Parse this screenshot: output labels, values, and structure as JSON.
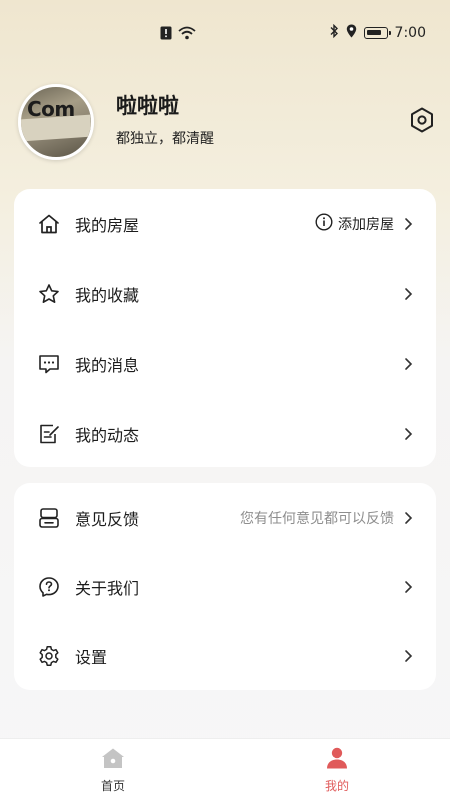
{
  "status_bar": {
    "time": "7:00",
    "battery_level": 0.85,
    "icons": [
      "alert-icon",
      "wifi-icon",
      "bluetooth-icon",
      "location-icon",
      "battery-icon"
    ]
  },
  "profile": {
    "name": "啦啦啦",
    "bio": "都独立，都清醒",
    "avatar_text": "Com"
  },
  "menu_card_1": [
    {
      "label": "我的房屋",
      "icon": "house-icon",
      "extra_icon": "info-icon",
      "extra_text": "添加房屋"
    },
    {
      "label": "我的收藏",
      "icon": "star-icon"
    },
    {
      "label": "我的消息",
      "icon": "message-icon"
    },
    {
      "label": "我的动态",
      "icon": "edit-note-icon"
    }
  ],
  "menu_card_2": [
    {
      "label": "意见反馈",
      "icon": "feedback-icon",
      "hint": "您有任何意见都可以反馈"
    },
    {
      "label": "关于我们",
      "icon": "question-icon"
    },
    {
      "label": "设置",
      "icon": "gear-icon"
    }
  ],
  "tab_bar": {
    "active": "我的",
    "tabs": [
      {
        "label": "首页",
        "icon": "home-icon"
      },
      {
        "label": "我的",
        "icon": "person-icon"
      }
    ]
  },
  "colors": {
    "accent": "#e05a5a",
    "header_bg": "#efe6cf",
    "page_bg": "#f7f7f8",
    "hint_text": "#8e8e8e"
  }
}
